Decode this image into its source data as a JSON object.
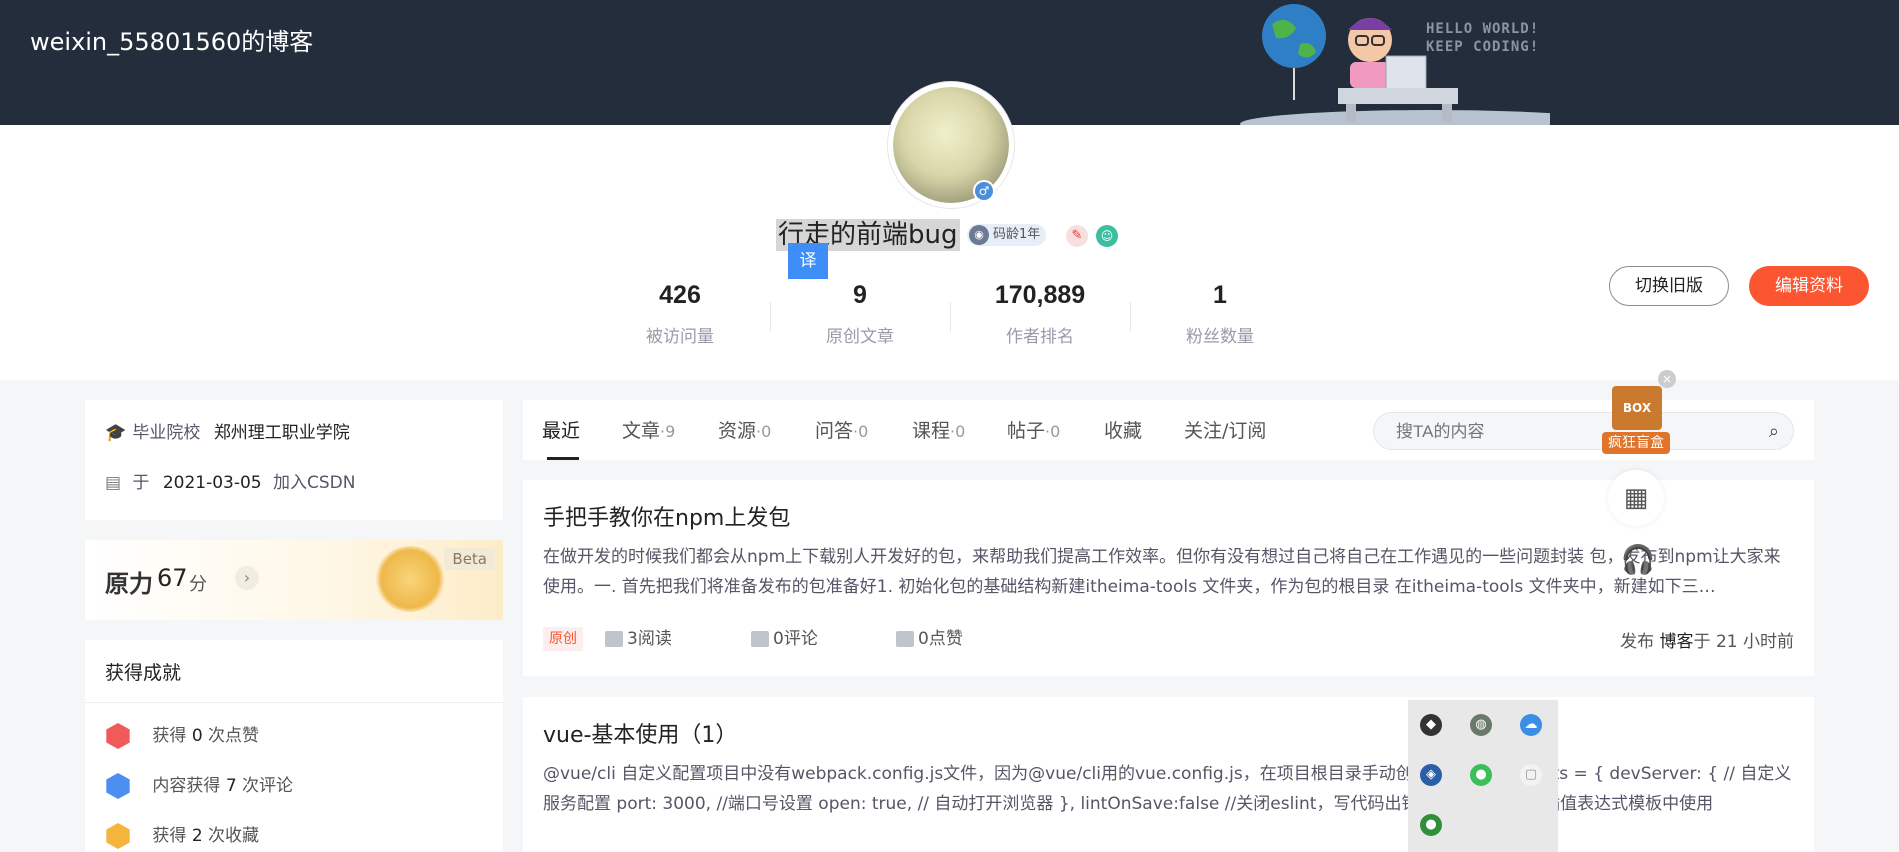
{
  "banner": {
    "blog_title": "weixin_55801560的博客",
    "slogan_line1": "HELLO WORLD!",
    "slogan_line2": "KEEP CODING!"
  },
  "profile": {
    "nickname": "行走的前端bug",
    "code_age_badge": "码龄1年",
    "translate_label": "译",
    "switch_old_label": "切换旧版",
    "edit_profile_label": "编辑资料",
    "stats": [
      {
        "value": "426",
        "label": "被访问量"
      },
      {
        "value": "9",
        "label": "原创文章"
      },
      {
        "value": "170,889",
        "label": "作者排名"
      },
      {
        "value": "1",
        "label": "粉丝数量"
      }
    ]
  },
  "sidebar": {
    "school_label": "毕业院校",
    "school_value": "郑州理工职业学院",
    "join_prefix": "于",
    "join_date": "2021-03-05",
    "join_suffix": "加入CSDN",
    "power_label": "原力",
    "power_value": "67",
    "power_unit": "分",
    "beta_label": "Beta",
    "achievements_title": "获得成就",
    "achievements": [
      {
        "prefix": "获得",
        "count": "0",
        "suffix": "次点赞",
        "color": "#f25a5a"
      },
      {
        "prefix": "内容获得",
        "count": "7",
        "suffix": "次评论",
        "color": "#4d8ff0"
      },
      {
        "prefix": "获得",
        "count": "2",
        "suffix": "次收藏",
        "color": "#f5b53d"
      }
    ]
  },
  "tabs": {
    "items": [
      {
        "label": "最近",
        "count": ""
      },
      {
        "label": "文章",
        "count": "·9"
      },
      {
        "label": "资源",
        "count": "·0"
      },
      {
        "label": "问答",
        "count": "·0"
      },
      {
        "label": "课程",
        "count": "·0"
      },
      {
        "label": "帖子",
        "count": "·0"
      },
      {
        "label": "收藏",
        "count": ""
      },
      {
        "label": "关注/订阅",
        "count": ""
      }
    ],
    "search_placeholder": "搜TA的内容"
  },
  "articles": [
    {
      "title": "手把手教你在npm上发包",
      "desc": "在做开发的时候我们都会从npm上下载别人开发好的包，来帮助我们提高工作效率。但你有没有想过自己将自己在工作遇见的一些问题封装 包，发布到npm让大家来使用。一. 首先把我们将准备发布的包准备好1. 初始化包的基础结构新建itheima-tools 文件夹，作为包的根目录 在itheima-tools 文件夹中，新建如下三…",
      "tag": "原创",
      "reads": "3阅读",
      "comments": "0评论",
      "likes": "0点赞",
      "pub_prefix": "发布",
      "pub_type": "博客",
      "pub_time": "于 21 小时前"
    },
    {
      "title": "vue-基本使用（1）",
      "desc": "@vue/cli 自定义配置项目中没有webpack.config.js文件，因为@vue/cli用的vue.config.js，在项目根目录手动创建 module.exports = { devServer: { // 自定义服务配置 port: 3000, //端口号设置 open: true, // 自动打开浏览器 }, lintOnSave:false //关闭eslint，写代码出错，控制台不报错|插值表达式模板中使用"
    }
  ],
  "floating": {
    "blind_box_label": "疯狂盲盒",
    "box_text": "BOX"
  }
}
